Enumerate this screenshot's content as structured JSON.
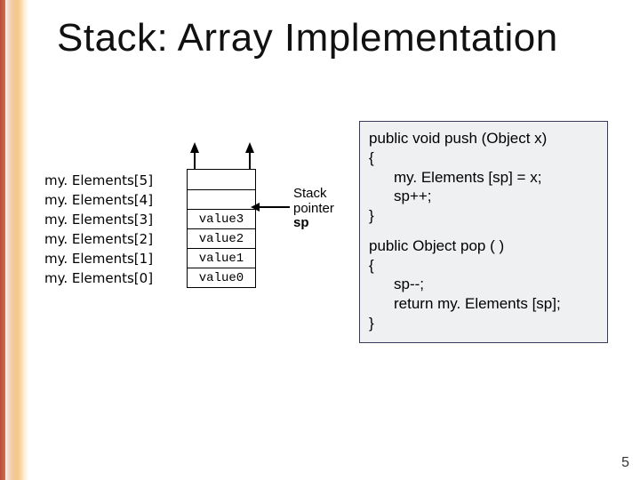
{
  "title": "Stack: Array Implementation",
  "diagram": {
    "row_labels": [
      "my. Elements[5]",
      "my. Elements[4]",
      "my. Elements[3]",
      "my. Elements[2]",
      "my. Elements[1]",
      "my. Elements[0]"
    ],
    "cells": [
      "",
      "",
      "value3",
      "value2",
      "value1",
      "value0"
    ],
    "pointer_label_line1": "Stack",
    "pointer_label_line2": "pointer",
    "pointer_name": "sp"
  },
  "code": {
    "push_sig": "public void push (Object x)",
    "open": "{",
    "push_l1": "my. Elements [sp] = x;",
    "push_l2": "sp++;",
    "close": "}",
    "pop_sig": "public Object pop ( )",
    "pop_l1": "sp--;",
    "pop_l2": "return my. Elements [sp];"
  },
  "page_number": "5"
}
